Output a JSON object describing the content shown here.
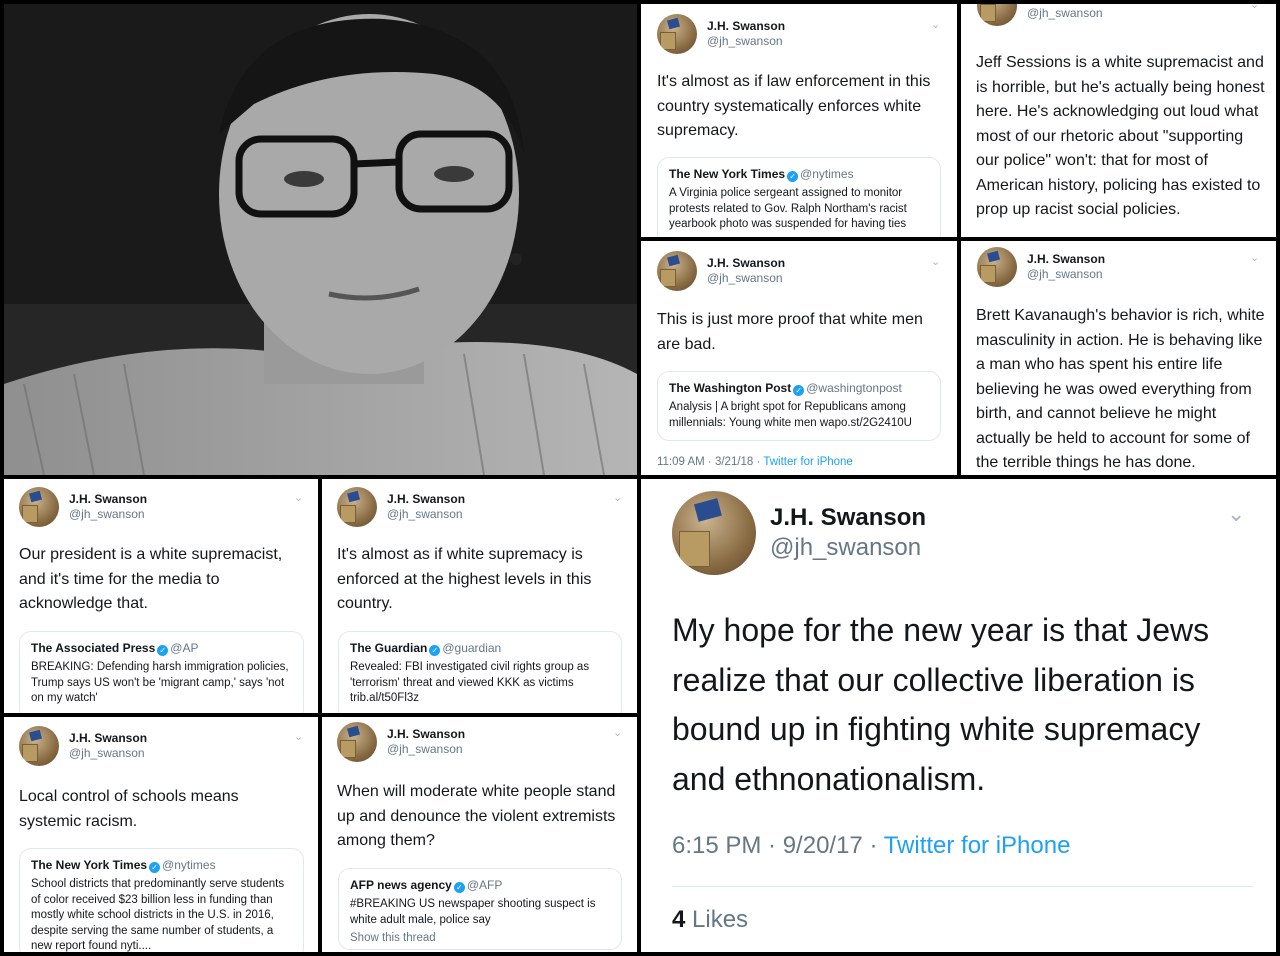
{
  "author": {
    "name": "J.H. Swanson",
    "handle": "@jh_swanson"
  },
  "tweets": {
    "t1": {
      "text": "It's almost as if law enforcement in this country systematically enforces white supremacy.",
      "quote": {
        "name": "The New York Times",
        "handle": "@nytimes",
        "text": "A Virginia police sergeant assigned to monitor protests related to Gov. Ralph Northam's racist yearbook photo was suspended for having ties"
      }
    },
    "t2": {
      "text": "Jeff Sessions is a white supremacist and is horrible, but he's actually being honest here. He's acknowledging out loud what most of our rhetoric about \"supporting our police\" won't: that for most of American history, policing has existed to prop up racist social policies."
    },
    "t3": {
      "text": "This is just more proof that white men are bad.",
      "quote": {
        "name": "The Washington Post",
        "handle": "@washingtonpost",
        "text": "Analysis | A bright spot for Republicans among millennials: Young white men wapo.st/2G2410U"
      },
      "time": "11:09 AM · 3/21/18 · ",
      "source": "Twitter for iPhone"
    },
    "t4": {
      "text": "Brett Kavanaugh's behavior is rich, white masculinity in action. He is behaving like a man who has spent his entire life believing he was owed everything from birth, and cannot believe he might actually be held to account for some of the terrible things he has done."
    },
    "t5": {
      "text": "Our president is a white supremacist, and it's time for the media to acknowledge that.",
      "quote": {
        "name": "The Associated Press",
        "handle": "@AP",
        "text": "BREAKING: Defending harsh immigration policies, Trump says US won't be 'migrant camp,' says 'not on my watch'"
      }
    },
    "t6": {
      "text": "It's almost as if white supremacy is enforced at the highest levels in this country.",
      "quote": {
        "name": "The Guardian",
        "handle": "@guardian",
        "text": "Revealed: FBI investigated civil rights group as 'terrorism' threat and viewed KKK as victims trib.al/t50Fl3z"
      }
    },
    "t7": {
      "text": "Local control of schools means systemic racism.",
      "quote": {
        "name": "The New York Times",
        "handle": "@nytimes",
        "text": "School districts that predominantly serve students of color received $23 billion less in funding than mostly white school districts in the U.S. in 2016, despite serving the same number of students, a new report found nyti...."
      }
    },
    "t8": {
      "text": "When will moderate white people stand up and denounce the violent extremists among them?",
      "quote": {
        "name": "AFP news agency",
        "handle": "@AFP",
        "text": "#BREAKING US newspaper shooting suspect is white adult male, police say",
        "link": "Show this thread"
      }
    },
    "t9": {
      "text": "My hope for the new year is that Jews realize that our collective liberation is bound up in fighting white supremacy and ethnonationalism.",
      "time": "6:15 PM · 9/20/17 · ",
      "source": "Twitter for iPhone",
      "likes_count": "4",
      "likes_label": " Likes"
    }
  },
  "icons": {
    "verified": "verified-badge-icon",
    "chevron": "chevron-down-icon"
  },
  "colors": {
    "link": "#1da1f2",
    "muted": "#657786",
    "background": "#000000"
  }
}
